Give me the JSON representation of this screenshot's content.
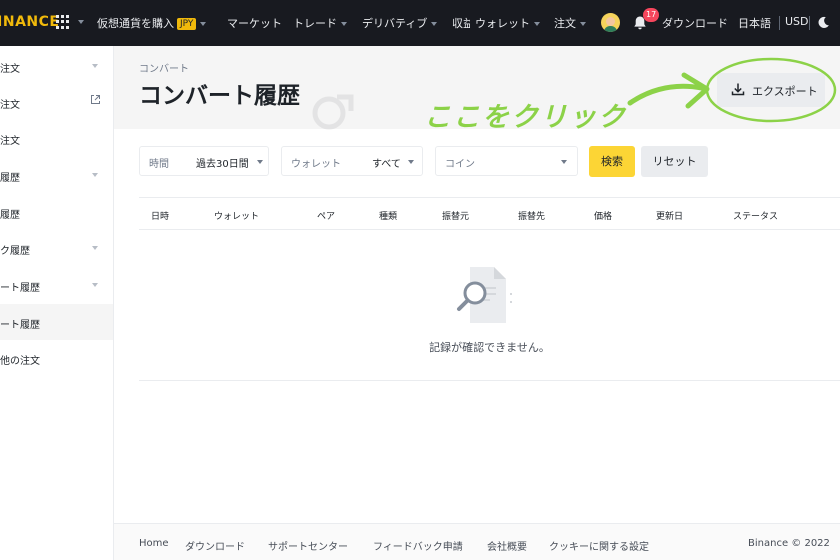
{
  "topnav": {
    "logo": "BINANCE",
    "buy_crypto": "仮想通貨を購入",
    "currency_badge": "JPY",
    "markets": "マーケット",
    "trade": "トレード",
    "derivatives": "デリバティブ",
    "earn": "収益",
    "wallet": "ウォレット",
    "orders": "注文",
    "notification_count": "17",
    "download": "ダウンロード",
    "language": "日本語",
    "currency": "USD"
  },
  "sidebar": {
    "items": [
      {
        "label": "現物注文"
      },
      {
        "label": "信用注文"
      },
      {
        "label": "先物注文"
      },
      {
        "label": "取引履歴"
      },
      {
        "label": "決済履歴"
      },
      {
        "label": "ロック履歴"
      },
      {
        "label": "コンバート履歴"
      },
      {
        "label": "コンバート履歴"
      },
      {
        "label": "その他の注文"
      }
    ]
  },
  "header": {
    "breadcrumb": "コンバート",
    "title": "コンバート履歴",
    "export_label": "エクスポート",
    "annotation": "ここをクリック"
  },
  "filters": {
    "time_label": "時間",
    "time_value": "過去30日間",
    "wallet_label": "ウォレット",
    "wallet_value": "すべて",
    "coin_placeholder": "コイン",
    "search_label": "検索",
    "reset_label": "リセット"
  },
  "table": {
    "columns": [
      "日時",
      "ウォレット",
      "ペア",
      "種類",
      "振替元",
      "振替先",
      "価格",
      "更新日",
      "ステータス"
    ],
    "empty_message": "記録が確認できません。"
  },
  "footer": {
    "links": [
      "Home",
      "ダウンロード",
      "サポートセンター",
      "フィードバック申請",
      "会社概要",
      "クッキーに関する設定"
    ],
    "copyright": "Binance © 2022"
  },
  "colors": {
    "nav_bg": "#181a20",
    "brand_yellow": "#f0b90b",
    "search_button": "#fcd535",
    "annotation_green": "#8cd248",
    "notification_red": "#f6465d"
  }
}
